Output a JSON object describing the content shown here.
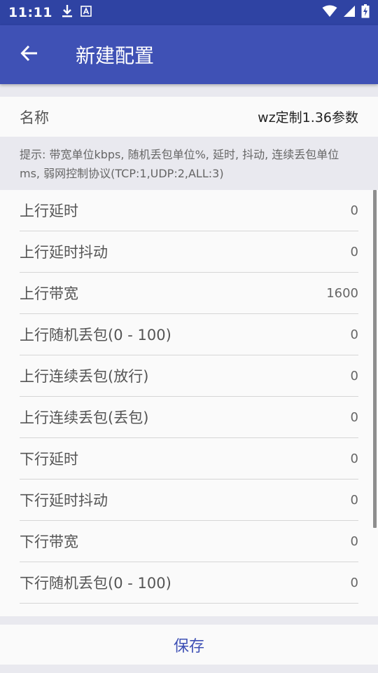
{
  "status_bar": {
    "time": "11:11",
    "icons_left": [
      "download-icon",
      "a-notification-icon"
    ],
    "icons_right": [
      "wifi-icon",
      "cell-signal-icon",
      "battery-charging-icon"
    ]
  },
  "app_bar": {
    "title": "新建配置",
    "back_icon": "arrow-back-icon",
    "color": "#3f51b5",
    "status_color": "#2f43a3"
  },
  "name_field": {
    "label": "名称",
    "value": "wz定制1.36参数"
  },
  "hint": "提示: 带宽单位kbps, 随机丢包单位%, 延时, 抖动, 连续丢包单位ms, 弱网控制协议(TCP:1,UDP:2,ALL:3)",
  "params": [
    {
      "label": "上行延时",
      "value": "0"
    },
    {
      "label": "上行延时抖动",
      "value": "0"
    },
    {
      "label": "上行带宽",
      "value": "1600"
    },
    {
      "label": "上行随机丢包(0 - 100)",
      "value": "0"
    },
    {
      "label": "上行连续丢包(放行)",
      "value": "0"
    },
    {
      "label": "上行连续丢包(丢包)",
      "value": "0"
    },
    {
      "label": "下行延时",
      "value": "0"
    },
    {
      "label": "下行延时抖动",
      "value": "0"
    },
    {
      "label": "下行带宽",
      "value": "0"
    },
    {
      "label": "下行随机丢包(0 - 100)",
      "value": "0"
    }
  ],
  "footer": {
    "save_label": "保存"
  }
}
